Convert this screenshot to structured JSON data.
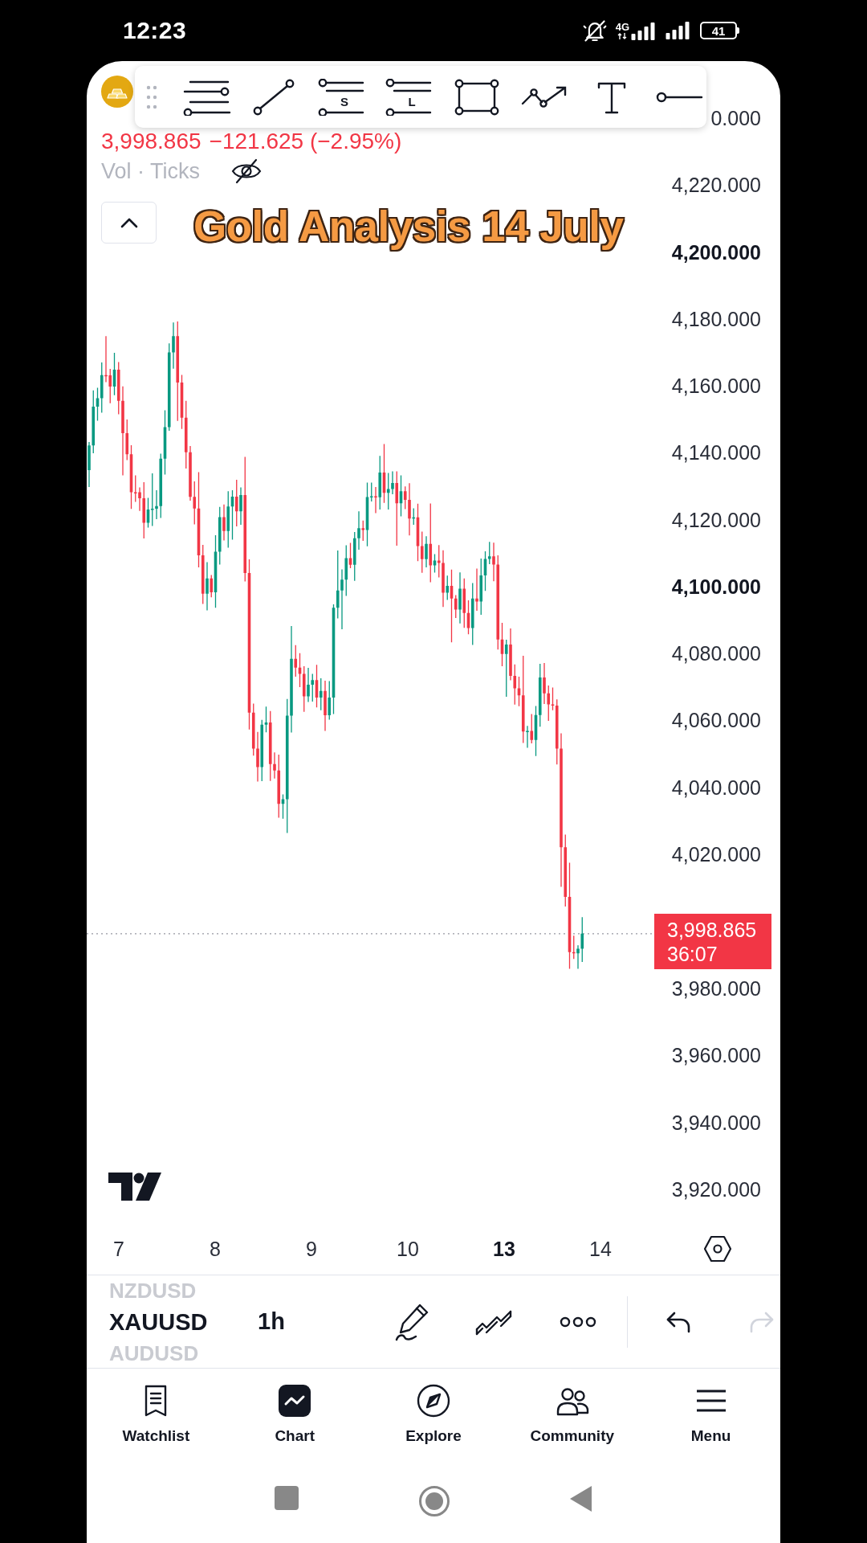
{
  "status_bar": {
    "time": "12:23",
    "network": "4G",
    "battery": "41"
  },
  "drawing_toolbar": {
    "tools": [
      {
        "kind": "fib"
      },
      {
        "kind": "trend_line"
      },
      {
        "kind": "labeled_lines",
        "letter": "S"
      },
      {
        "kind": "labeled_lines",
        "letter": "L"
      },
      {
        "kind": "rectangle"
      },
      {
        "kind": "path"
      },
      {
        "kind": "text"
      },
      {
        "kind": "ray"
      }
    ]
  },
  "legend": {
    "last_price": "3,998.865",
    "change": "−121.625 (−2.95%)",
    "falling": true,
    "indicator": {
      "label": "Vol · Ticks",
      "visible": false
    },
    "expanded": true
  },
  "title_overlay": "Gold Analysis 14 July",
  "price_axis": {
    "upper_ticks": [
      {
        "label": "0.000",
        "major": false
      },
      {
        "label": "4,220.000",
        "major": false
      },
      {
        "label": "4,200.000",
        "major": true
      },
      {
        "label": "4,180.000",
        "major": false
      },
      {
        "label": "4,160.000",
        "major": false
      },
      {
        "label": "4,140.000",
        "major": false
      },
      {
        "label": "4,120.000",
        "major": false
      },
      {
        "label": "4,100.000",
        "major": true
      },
      {
        "label": "4,080.000",
        "major": false
      },
      {
        "label": "4,060.000",
        "major": false
      },
      {
        "label": "4,040.000",
        "major": false
      },
      {
        "label": "4,020.000",
        "major": false
      }
    ],
    "current_price": {
      "price": "3,998.865",
      "countdown": "36:07",
      "falling": true
    },
    "lower_ticks": [
      {
        "label": "3,980.000",
        "major": false
      },
      {
        "label": "3,960.000",
        "major": false
      },
      {
        "label": "3,940.000",
        "major": false
      },
      {
        "label": "3,920.000",
        "major": false
      }
    ]
  },
  "time_axis": [
    {
      "label": "7",
      "major": false
    },
    {
      "label": "8",
      "major": false
    },
    {
      "label": "9",
      "major": false
    },
    {
      "label": "10",
      "major": false
    },
    {
      "label": "13",
      "major": true
    },
    {
      "label": "14",
      "major": false
    }
  ],
  "symbol_bar": {
    "symbols": [
      {
        "label": "NZDUSD",
        "selected": false
      },
      {
        "label": "XAUUSD",
        "selected": true
      },
      {
        "label": "AUDUSD",
        "selected": false
      }
    ],
    "timeframe": "1h",
    "history": [
      {
        "disabled": false
      },
      {
        "disabled": true
      }
    ]
  },
  "bottom_nav": [
    {
      "label": "Watchlist",
      "selected": false
    },
    {
      "label": "Chart",
      "selected": true
    },
    {
      "label": "Explore",
      "selected": false
    },
    {
      "label": "Community",
      "selected": false
    },
    {
      "label": "Menu",
      "selected": false
    }
  ]
}
